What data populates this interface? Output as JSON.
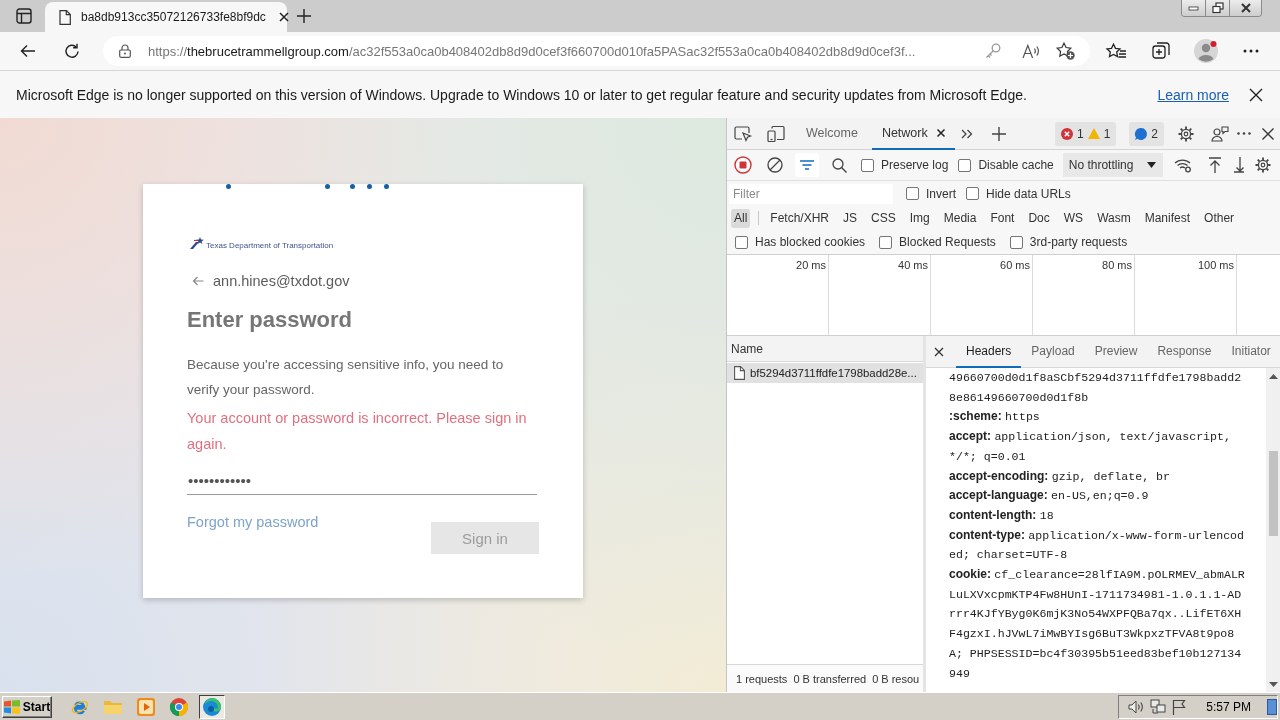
{
  "browser": {
    "tab": {
      "title": "ba8db913cc35072126733fe8bf9dc",
      "selected": true
    },
    "address": {
      "scheme": "https://",
      "host": "thebrucetrammellgroup.com",
      "path": "/ac32f553a0ca0b408402db8d9d0cef3f660700d010fa5PASac32f553a0ca0b408402db8d9d0cef3f..."
    }
  },
  "infobar": {
    "message": "Microsoft Edge is no longer supported on this version of Windows. Upgrade to Windows 10 or later to get regular feature and security updates from Microsoft Edge.",
    "link": "Learn more"
  },
  "login": {
    "logo_text": "Texas Department of Transportation",
    "email": "ann.hines@txdot.gov",
    "title": "Enter password",
    "description": "Because you're accessing sensitive info, you need to verify your password.",
    "error": "Your account or password is incorrect. Please sign in again.",
    "password": {
      "value": "••••••••••••"
    },
    "forgot_link": "Forgot my password",
    "sign_in": {
      "label": "Sign in",
      "disabled": true
    }
  },
  "devtools": {
    "tabs": [
      {
        "label": "Welcome",
        "selected": false,
        "closable": false
      },
      {
        "label": "Network",
        "selected": true,
        "closable": true
      }
    ],
    "counters": [
      {
        "items": [
          {
            "kind": "error",
            "count": "1"
          },
          {
            "kind": "warning",
            "count": "1"
          }
        ]
      },
      {
        "items": [
          {
            "kind": "message",
            "count": "2"
          }
        ]
      }
    ],
    "toolbar": {
      "recording": true,
      "filter_on": true,
      "checkboxes": [
        {
          "label": "Preserve log",
          "checked": false
        },
        {
          "label": "Disable cache",
          "checked": false
        }
      ],
      "throttling": "No throttling"
    },
    "filter": {
      "placeholder": "Filter",
      "checkboxes": [
        {
          "label": "Invert",
          "checked": false
        },
        {
          "label": "Hide data URLs",
          "checked": false
        }
      ]
    },
    "types": [
      {
        "label": "All",
        "selected": true
      },
      {
        "label": "Fetch/XHR",
        "selected": false
      },
      {
        "label": "JS",
        "selected": false
      },
      {
        "label": "CSS",
        "selected": false
      },
      {
        "label": "Img",
        "selected": false
      },
      {
        "label": "Media",
        "selected": false
      },
      {
        "label": "Font",
        "selected": false
      },
      {
        "label": "Doc",
        "selected": false
      },
      {
        "label": "WS",
        "selected": false
      },
      {
        "label": "Wasm",
        "selected": false
      },
      {
        "label": "Manifest",
        "selected": false
      },
      {
        "label": "Other",
        "selected": false
      }
    ],
    "more_filters": [
      {
        "label": "Has blocked cookies",
        "checked": false
      },
      {
        "label": "Blocked Requests",
        "checked": false
      },
      {
        "label": "3rd-party requests",
        "checked": false
      }
    ],
    "timeline_ticks": [
      "20 ms",
      "40 ms",
      "60 ms",
      "80 ms",
      "100 ms"
    ],
    "requests": {
      "column": "Name",
      "rows": [
        {
          "name": "bf5294d3711ffdfe1798badd28e...",
          "selected": true
        }
      ],
      "summary": [
        "1 requests",
        "0 B transferred",
        "0 B resou"
      ]
    },
    "details": {
      "tabs": [
        {
          "label": "Headers",
          "selected": true
        },
        {
          "label": "Payload",
          "selected": false
        },
        {
          "label": "Preview",
          "selected": false
        },
        {
          "label": "Response",
          "selected": false
        },
        {
          "label": "Initiator",
          "selected": false
        }
      ],
      "headers": [
        {
          "value": "49660700d0d1f8aSCbf5294d3711ffdfe1798badd28e86149660700d0d1f8b"
        },
        {
          "name": ":scheme:",
          "value": "https"
        },
        {
          "name": "accept:",
          "value": "application/json, text/javascript, */*; q=0.01"
        },
        {
          "name": "accept-encoding:",
          "value": "gzip, deflate, br"
        },
        {
          "name": "accept-language:",
          "value": "en-US,en;q=0.9"
        },
        {
          "name": "content-length:",
          "value": "18"
        },
        {
          "name": "content-type:",
          "value": "application/x-www-form-urlencoded; charset=UTF-8"
        },
        {
          "name": "cookie:",
          "value": "cf_clearance=28lfIA9M.pOLRMEV_abmALRLuLXVxcpmKTP4Fw8HUnI-1711734981-1.0.1.1-ADrrr4KJfYByg0K6mjK3No54WXPFQBa7qx..LifET6XHF4gzxI.hJVwL7iMwBYIsg6BuT3WkpxzTFVA8t9po8A; PHPSESSID=bc4f30395b51eed83bef10b127134949"
        }
      ]
    }
  },
  "taskbar": {
    "start": "Start",
    "apps": [
      {
        "kind": "ie",
        "active": false
      },
      {
        "kind": "folder",
        "active": false
      },
      {
        "kind": "media",
        "active": false
      },
      {
        "kind": "chrome",
        "active": false
      },
      {
        "kind": "edge",
        "active": true
      }
    ],
    "clock": "5:57 PM"
  }
}
